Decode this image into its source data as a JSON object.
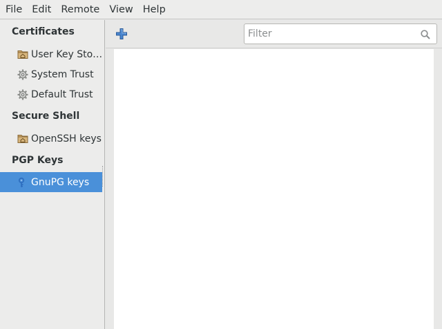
{
  "menubar": {
    "items": [
      "File",
      "Edit",
      "Remote",
      "View",
      "Help"
    ]
  },
  "sidebar": {
    "sections": [
      {
        "title": "Certificates",
        "items": [
          {
            "label": "User Key Sto…",
            "icon": "folder-home-icon",
            "selected": false
          },
          {
            "label": "System Trust",
            "icon": "gear-icon",
            "selected": false
          },
          {
            "label": "Default Trust",
            "icon": "gear-icon",
            "selected": false
          }
        ]
      },
      {
        "title": "Secure Shell",
        "items": [
          {
            "label": "OpenSSH keys",
            "icon": "folder-home-icon",
            "selected": false
          }
        ]
      },
      {
        "title": "PGP Keys",
        "items": [
          {
            "label": "GnuPG keys",
            "icon": "key-ring-icon",
            "selected": true
          }
        ]
      }
    ]
  },
  "toolbar": {
    "add_icon": "add-icon",
    "filter_placeholder": "Filter",
    "filter_value": "",
    "search_icon": "search-icon"
  },
  "colors": {
    "selection": "#4a90d9",
    "add_icon": "#3a6fb0"
  }
}
